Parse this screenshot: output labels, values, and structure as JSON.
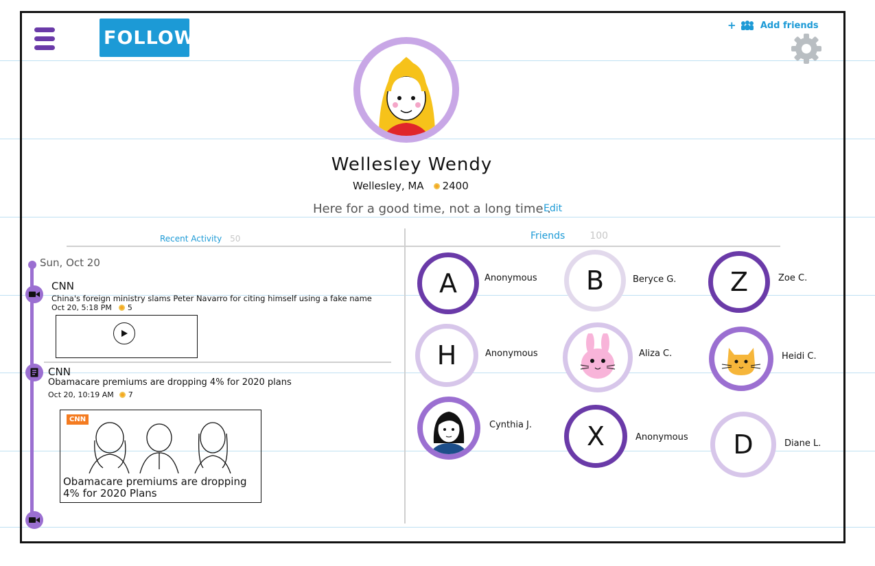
{
  "header": {
    "menu_icon": "hamburger-menu-icon",
    "follow_label": "FOLLOW",
    "add_friends_label": "Add friends",
    "add_friends_prefix": "+",
    "settings_icon": "gear-icon"
  },
  "colors": {
    "accent_blue": "#1c9ad6",
    "purple_dark": "#6a3aa8",
    "purple_mid": "#9b6fd1",
    "purple_light": "#d7c6ea",
    "coin": "#f6a623"
  },
  "profile": {
    "name": "Wellesley Wendy",
    "location": "Wellesley, MA",
    "points": "2400",
    "bio": "Here for a good time, not a long time .",
    "edit_label": "Edit"
  },
  "tabs": {
    "recent_label": "Recent Activity",
    "recent_count": "50",
    "friends_label": "Friends",
    "friends_count": "100"
  },
  "timeline": {
    "date": "Sun, Oct 20",
    "items": [
      {
        "source": "CNN",
        "headline": "China's foreign ministry slams Peter Navarro for citing himself using a fake name",
        "time": "Oct 20, 5:18 PM",
        "points": "5",
        "type_icon": "video-camera-icon"
      },
      {
        "source": "CNN",
        "headline": "Obamacare premiums are dropping 4% for 2020 plans",
        "time": "Oct 20, 10:19 AM",
        "points": "7",
        "type_icon": "article-icon",
        "image_tag": "CNN",
        "image_caption": "Obamacare premiums are dropping 4% for 2020 Plans"
      }
    ],
    "end_icon": "video-camera-icon"
  },
  "friends": [
    {
      "initial": "A",
      "name": "Anonymous",
      "ring": "dark"
    },
    {
      "initial": "B",
      "name": "Beryce G.",
      "ring": "pale"
    },
    {
      "initial": "Z",
      "name": "Zoe C.",
      "ring": "dark"
    },
    {
      "initial": "H",
      "name": "Anonymous",
      "ring": "light"
    },
    {
      "initial": "",
      "name": "Aliza C.",
      "ring": "light",
      "avatar": "bunny-avatar"
    },
    {
      "initial": "",
      "name": "Heidi C.",
      "ring": "mid",
      "avatar": "cat-avatar"
    },
    {
      "initial": "",
      "name": "Cynthia J.",
      "ring": "mid",
      "avatar": "girl-avatar"
    },
    {
      "initial": "X",
      "name": "Anonymous",
      "ring": "dark"
    },
    {
      "initial": "D",
      "name": "Diane L.",
      "ring": "light"
    }
  ]
}
